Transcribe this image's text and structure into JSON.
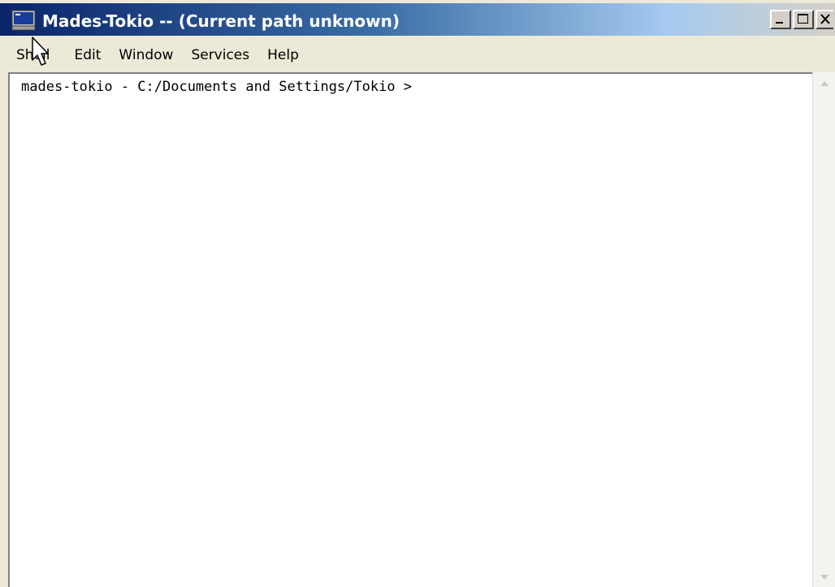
{
  "window": {
    "title": "Mades-Tokio -- (Current path unknown)"
  },
  "menu": {
    "items": [
      {
        "label": "Shell"
      },
      {
        "label": "Edit"
      },
      {
        "label": "Window"
      },
      {
        "label": "Services"
      },
      {
        "label": "Help"
      }
    ]
  },
  "terminal": {
    "prompt": "mades-tokio - C:/Documents and Settings/Tokio >"
  },
  "icons": {
    "app": "terminal-icon",
    "minimize": "minimize-icon",
    "maximize": "maximize-icon",
    "close": "close-icon",
    "cursor": "mouse-pointer-icon"
  },
  "colors": {
    "titlebar_start": "#0a246a",
    "titlebar_end": "#d4d0c8",
    "terminal_bg": "#ffffff"
  }
}
